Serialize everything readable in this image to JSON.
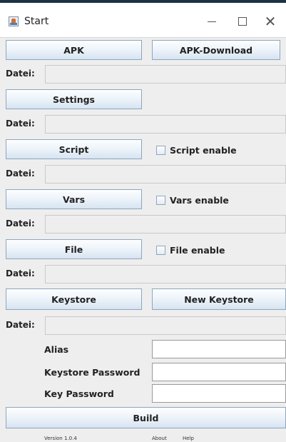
{
  "window": {
    "title": "Start"
  },
  "buttons": {
    "apk": "APK",
    "apk_download": "APK-Download",
    "settings": "Settings",
    "script": "Script",
    "vars": "Vars",
    "file": "File",
    "keystore": "Keystore",
    "new_keystore": "New Keystore",
    "build": "Build"
  },
  "file_label": "Datei:",
  "checkboxes": {
    "script": {
      "label": "Script enable",
      "checked": false
    },
    "vars": {
      "label": "Vars enable",
      "checked": false
    },
    "file": {
      "label": "File enable",
      "checked": false
    }
  },
  "keystore_fields": {
    "alias": {
      "label": "Alias",
      "value": ""
    },
    "keystore_password": {
      "label": "Keystore Password",
      "value": ""
    },
    "key_password": {
      "label": "Key Password",
      "value": ""
    }
  },
  "footer": {
    "version": "Version 1.0.4",
    "about": "About",
    "help": "Help"
  }
}
